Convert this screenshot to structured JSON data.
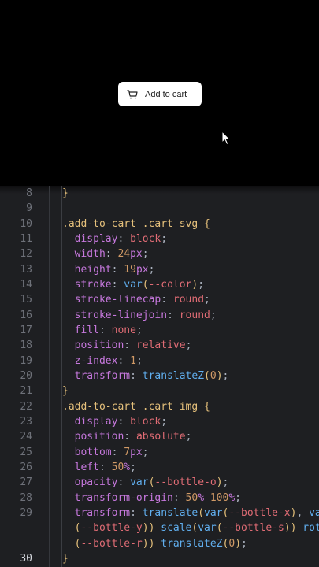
{
  "preview": {
    "button_label": "Add to cart",
    "button_icon": "cart-icon",
    "cursor_icon": "pointer-cursor-icon"
  },
  "editor": {
    "lines": [
      {
        "n": "8",
        "tokens": [
          {
            "c": "t-brace",
            "t": "}"
          }
        ]
      },
      {
        "n": "9",
        "tokens": []
      },
      {
        "n": "10",
        "tokens": [
          {
            "c": "t-sel",
            "t": ".add-to-cart .cart svg "
          },
          {
            "c": "t-brace",
            "t": "{"
          }
        ]
      },
      {
        "n": "11",
        "tokens": [
          {
            "c": "t-prop",
            "t": "  display"
          },
          {
            "c": "t-punc",
            "t": ": "
          },
          {
            "c": "t-kw",
            "t": "block"
          },
          {
            "c": "t-punc",
            "t": ";"
          }
        ]
      },
      {
        "n": "12",
        "tokens": [
          {
            "c": "t-prop",
            "t": "  width"
          },
          {
            "c": "t-punc",
            "t": ": "
          },
          {
            "c": "t-num",
            "t": "24"
          },
          {
            "c": "t-unit",
            "t": "px"
          },
          {
            "c": "t-punc",
            "t": ";"
          }
        ]
      },
      {
        "n": "13",
        "tokens": [
          {
            "c": "t-prop",
            "t": "  height"
          },
          {
            "c": "t-punc",
            "t": ": "
          },
          {
            "c": "t-num",
            "t": "19"
          },
          {
            "c": "t-unit",
            "t": "px"
          },
          {
            "c": "t-punc",
            "t": ";"
          }
        ]
      },
      {
        "n": "14",
        "tokens": [
          {
            "c": "t-prop",
            "t": "  stroke"
          },
          {
            "c": "t-punc",
            "t": ": "
          },
          {
            "c": "t-fn",
            "t": "var"
          },
          {
            "c": "t-paren",
            "t": "("
          },
          {
            "c": "t-var",
            "t": "--color"
          },
          {
            "c": "t-paren",
            "t": ")"
          },
          {
            "c": "t-punc",
            "t": ";"
          }
        ]
      },
      {
        "n": "15",
        "tokens": [
          {
            "c": "t-prop",
            "t": "  stroke-linecap"
          },
          {
            "c": "t-punc",
            "t": ": "
          },
          {
            "c": "t-kw",
            "t": "round"
          },
          {
            "c": "t-punc",
            "t": ";"
          }
        ]
      },
      {
        "n": "16",
        "tokens": [
          {
            "c": "t-prop",
            "t": "  stroke-linejoin"
          },
          {
            "c": "t-punc",
            "t": ": "
          },
          {
            "c": "t-kw",
            "t": "round"
          },
          {
            "c": "t-punc",
            "t": ";"
          }
        ]
      },
      {
        "n": "17",
        "tokens": [
          {
            "c": "t-prop",
            "t": "  fill"
          },
          {
            "c": "t-punc",
            "t": ": "
          },
          {
            "c": "t-kw",
            "t": "none"
          },
          {
            "c": "t-punc",
            "t": ";"
          }
        ]
      },
      {
        "n": "18",
        "tokens": [
          {
            "c": "t-prop",
            "t": "  position"
          },
          {
            "c": "t-punc",
            "t": ": "
          },
          {
            "c": "t-kw",
            "t": "relative"
          },
          {
            "c": "t-punc",
            "t": ";"
          }
        ]
      },
      {
        "n": "19",
        "tokens": [
          {
            "c": "t-prop",
            "t": "  z-index"
          },
          {
            "c": "t-punc",
            "t": ": "
          },
          {
            "c": "t-num",
            "t": "1"
          },
          {
            "c": "t-punc",
            "t": ";"
          }
        ]
      },
      {
        "n": "20",
        "tokens": [
          {
            "c": "t-prop",
            "t": "  transform"
          },
          {
            "c": "t-punc",
            "t": ": "
          },
          {
            "c": "t-fn",
            "t": "translateZ"
          },
          {
            "c": "t-paren",
            "t": "("
          },
          {
            "c": "t-num",
            "t": "0"
          },
          {
            "c": "t-paren",
            "t": ")"
          },
          {
            "c": "t-punc",
            "t": ";"
          }
        ]
      },
      {
        "n": "21",
        "tokens": [
          {
            "c": "t-brace",
            "t": "}"
          }
        ]
      },
      {
        "n": "22",
        "tokens": [
          {
            "c": "t-sel",
            "t": ".add-to-cart .cart img "
          },
          {
            "c": "t-brace",
            "t": "{"
          }
        ]
      },
      {
        "n": "23",
        "tokens": [
          {
            "c": "t-prop",
            "t": "  display"
          },
          {
            "c": "t-punc",
            "t": ": "
          },
          {
            "c": "t-kw",
            "t": "block"
          },
          {
            "c": "t-punc",
            "t": ";"
          }
        ]
      },
      {
        "n": "24",
        "tokens": [
          {
            "c": "t-prop",
            "t": "  position"
          },
          {
            "c": "t-punc",
            "t": ": "
          },
          {
            "c": "t-kw",
            "t": "absolute"
          },
          {
            "c": "t-punc",
            "t": ";"
          }
        ]
      },
      {
        "n": "25",
        "tokens": [
          {
            "c": "t-prop",
            "t": "  bottom"
          },
          {
            "c": "t-punc",
            "t": ": "
          },
          {
            "c": "t-num",
            "t": "7"
          },
          {
            "c": "t-unit",
            "t": "px"
          },
          {
            "c": "t-punc",
            "t": ";"
          }
        ]
      },
      {
        "n": "26",
        "tokens": [
          {
            "c": "t-prop",
            "t": "  left"
          },
          {
            "c": "t-punc",
            "t": ": "
          },
          {
            "c": "t-num",
            "t": "50"
          },
          {
            "c": "t-unit",
            "t": "%"
          },
          {
            "c": "t-punc",
            "t": ";"
          }
        ]
      },
      {
        "n": "27",
        "tokens": [
          {
            "c": "t-prop",
            "t": "  opacity"
          },
          {
            "c": "t-punc",
            "t": ": "
          },
          {
            "c": "t-fn",
            "t": "var"
          },
          {
            "c": "t-paren",
            "t": "("
          },
          {
            "c": "t-var",
            "t": "--bottle-o"
          },
          {
            "c": "t-paren",
            "t": ")"
          },
          {
            "c": "t-punc",
            "t": ";"
          }
        ]
      },
      {
        "n": "28",
        "tokens": [
          {
            "c": "t-prop",
            "t": "  transform-origin"
          },
          {
            "c": "t-punc",
            "t": ": "
          },
          {
            "c": "t-num",
            "t": "50"
          },
          {
            "c": "t-unit",
            "t": "%"
          },
          {
            "c": "t-punc",
            "t": " "
          },
          {
            "c": "t-num",
            "t": "100"
          },
          {
            "c": "t-unit",
            "t": "%"
          },
          {
            "c": "t-punc",
            "t": ";"
          }
        ]
      },
      {
        "n": "29",
        "tokens": [
          {
            "c": "t-prop",
            "t": "  transform"
          },
          {
            "c": "t-punc",
            "t": ": "
          },
          {
            "c": "t-fn",
            "t": "translate"
          },
          {
            "c": "t-paren",
            "t": "("
          },
          {
            "c": "t-fn",
            "t": "var"
          },
          {
            "c": "t-paren",
            "t": "("
          },
          {
            "c": "t-var",
            "t": "--bottle-x"
          },
          {
            "c": "t-paren",
            "t": ")"
          },
          {
            "c": "t-punc",
            "t": ", "
          },
          {
            "c": "t-fn",
            "t": "var"
          }
        ]
      },
      {
        "n": "",
        "tokens": [
          {
            "c": "t-paren",
            "t": "  ("
          },
          {
            "c": "t-var",
            "t": "--bottle-y"
          },
          {
            "c": "t-paren",
            "t": "))"
          },
          {
            "c": "t-punc",
            "t": " "
          },
          {
            "c": "t-fn",
            "t": "scale"
          },
          {
            "c": "t-paren",
            "t": "("
          },
          {
            "c": "t-fn",
            "t": "var"
          },
          {
            "c": "t-paren",
            "t": "("
          },
          {
            "c": "t-var",
            "t": "--bottle-s"
          },
          {
            "c": "t-paren",
            "t": "))"
          },
          {
            "c": "t-punc",
            "t": " "
          },
          {
            "c": "t-fn",
            "t": "rota"
          }
        ]
      },
      {
        "n": "",
        "tokens": [
          {
            "c": "t-paren",
            "t": "  ("
          },
          {
            "c": "t-var",
            "t": "--bottle-r"
          },
          {
            "c": "t-paren",
            "t": "))"
          },
          {
            "c": "t-punc",
            "t": " "
          },
          {
            "c": "t-fn",
            "t": "translateZ"
          },
          {
            "c": "t-paren",
            "t": "("
          },
          {
            "c": "t-num",
            "t": "0"
          },
          {
            "c": "t-paren",
            "t": ")"
          },
          {
            "c": "t-punc",
            "t": ";"
          }
        ]
      },
      {
        "n": "30",
        "active": true,
        "tokens": [
          {
            "c": "t-brace",
            "t": "}"
          }
        ]
      }
    ]
  }
}
